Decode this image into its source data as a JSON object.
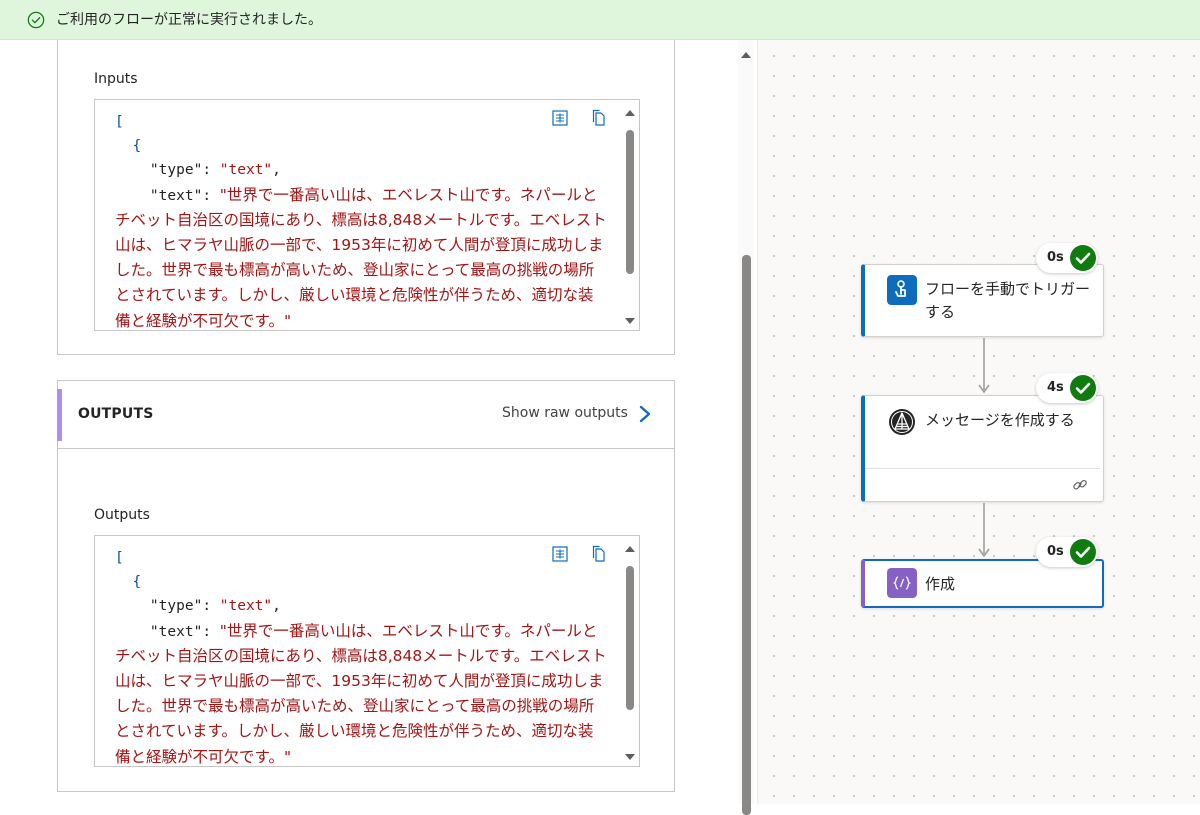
{
  "banner": {
    "message": "ご利用のフローが正常に実行されました。"
  },
  "inputs": {
    "label": "Inputs",
    "code": {
      "open_bracket": "[",
      "open_brace": "{",
      "type_key": "\"type\"",
      "type_value": "\"text\"",
      "text_key": "\"text\"",
      "text_value": "\"世界で一番高い山は、エベレスト山です。ネパールとチベット自治区の国境にあり、標高は8,848メートルです。エベレスト山は、ヒマラヤ山脈の一部で、1953年に初めて人間が登頂に成功しました。世界で最も標高が高いため、登山家にとって最高の挑戦の場所とされています。しかし、厳しい環境と危険性が伴うため、適切な装備と経験が不可欠です。\""
    }
  },
  "outputs": {
    "header": "OUTPUTS",
    "raw_link": "Show raw outputs",
    "label": "Outputs",
    "code": {
      "open_bracket": "[",
      "open_brace": "{",
      "type_key": "\"type\"",
      "type_value": "\"text\"",
      "text_key": "\"text\"",
      "text_value": "\"世界で一番高い山は、エベレスト山です。ネパールとチベット自治区の国境にあり、標高は8,848メートルです。エベレスト山は、ヒマラヤ山脈の一部で、1953年に初めて人間が登頂に成功しました。世界で最も標高が高いため、登山家にとって最高の挑戦の場所とされています。しかし、厳しい環境と危険性が伴うため、適切な装備と経験が不可欠です。\""
    }
  },
  "flow": {
    "nodes": [
      {
        "label": "フローを手動でトリガーする",
        "duration": "0s",
        "icon": "touch-trigger-icon",
        "icon_color": "#0f6cbd"
      },
      {
        "label": "メッセージを作成する",
        "duration": "4s",
        "icon": "ai-builder-icon",
        "icon_color": "#242424"
      },
      {
        "label": "作成",
        "duration": "0s",
        "icon": "compose-icon",
        "icon_color": "#8661c5"
      }
    ]
  },
  "colors": {
    "success": "#107c10",
    "banner_bg": "#dff6dd",
    "accent": "#0f6cbd",
    "outputs_accent": "#a98ff5",
    "string": "#a31515"
  }
}
